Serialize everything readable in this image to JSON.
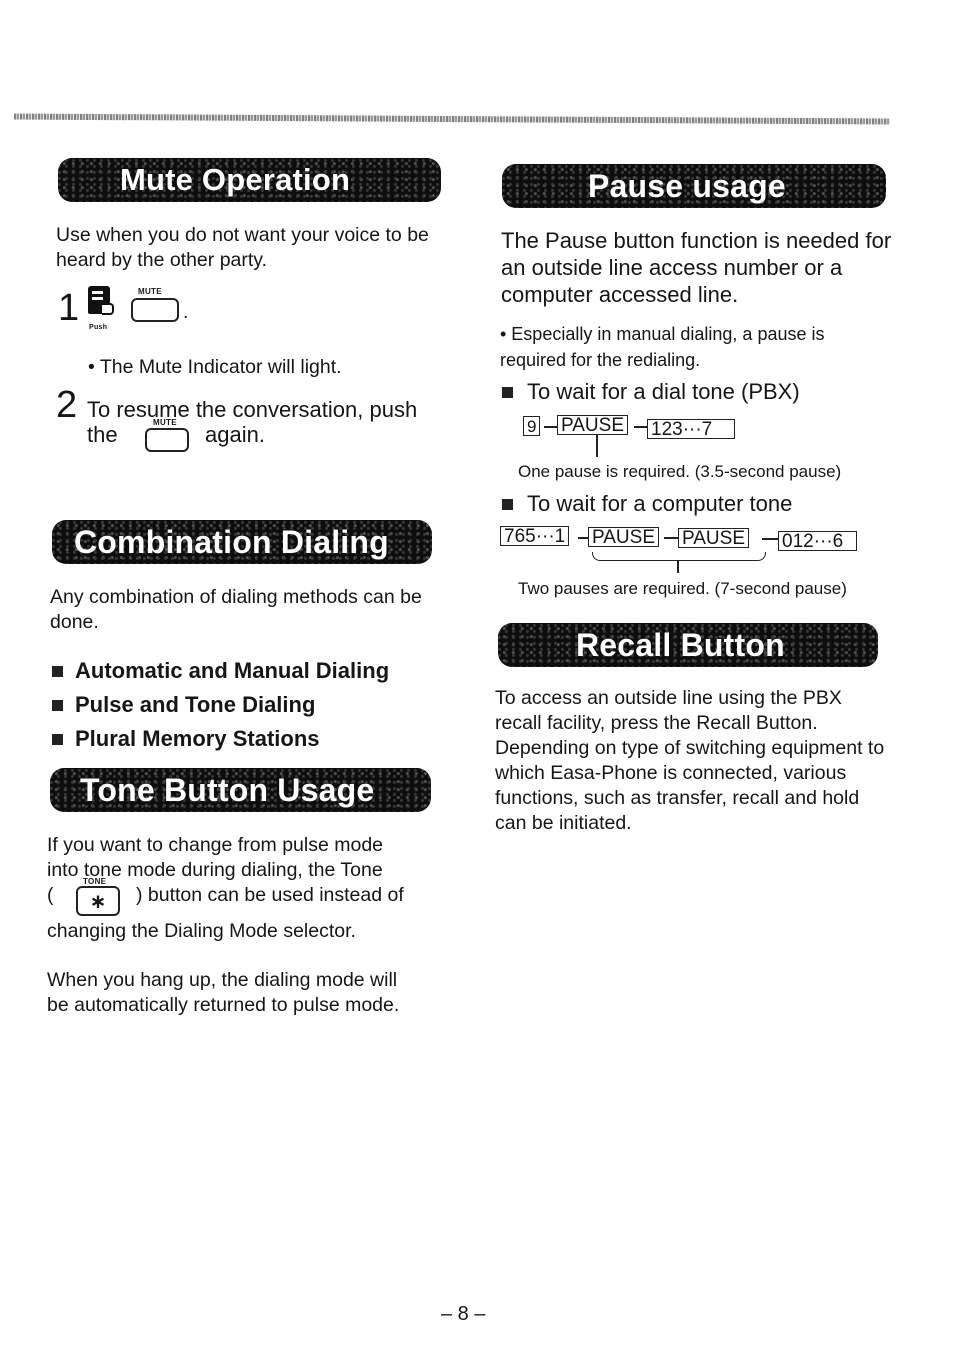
{
  "page_number": "– 8 –",
  "mute": {
    "title": "Mute Operation",
    "intro": "Use when you do not want your voice to be heard by the other party.",
    "step1_number": "1",
    "push_label": "Push",
    "mute_key_label": "MUTE",
    "step1_tail": ".",
    "step1_note": "• The Mute Indicator will light.",
    "step2_number": "2",
    "step2_line1": "To resume the conversation, push",
    "step2_pre": "the",
    "step2_post": "again."
  },
  "combination": {
    "title": "Combination Dialing",
    "intro": "Any combination of dialing methods can be done.",
    "items": [
      "Automatic and Manual Dialing",
      "Pulse and Tone Dialing",
      "Plural Memory Stations"
    ]
  },
  "tone": {
    "title": "Tone Button Usage",
    "para1_line1": "If you want to change from pulse mode",
    "para1_line2": "into tone mode during dialing, the Tone",
    "para1_open": "(",
    "tone_key_label": "TONE",
    "tone_key_symbol": "∗",
    "para1_line3": ") button can be used instead of",
    "para1_line4": "changing the Dialing Mode selector.",
    "para2": "When you hang up, the dialing mode will be automatically returned to pulse mode."
  },
  "pause": {
    "title": "Pause usage",
    "intro": "The Pause button function is needed for an outside line access number or a computer accessed line.",
    "note": "• Especially in manual dialing, a pause is required for the redialing.",
    "case1": {
      "heading": "To wait for a dial tone (PBX)",
      "boxes": [
        "9",
        "PAUSE",
        "123···7"
      ],
      "caption": "One pause is required. (3.5-second pause)"
    },
    "case2": {
      "heading": "To wait for a computer tone",
      "boxes": [
        "765···1",
        "PAUSE",
        "PAUSE",
        "012···6"
      ],
      "caption": "Two pauses are required. (7-second pause)"
    }
  },
  "recall": {
    "title": "Recall Button",
    "body": "To access an outside line using the PBX recall facility, press the Recall Button. Depending on type of switching equipment to which Easa-Phone is connected, various functions, such as transfer, recall and hold can be initiated."
  }
}
